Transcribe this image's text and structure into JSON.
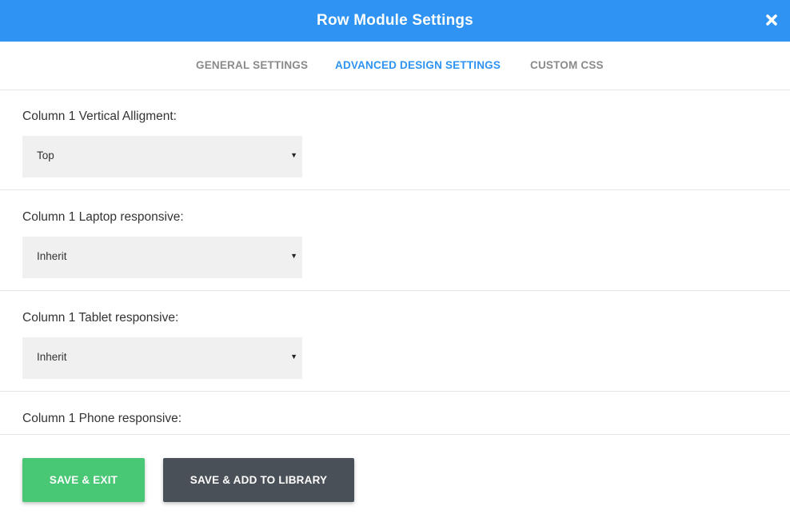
{
  "header": {
    "title": "Row Module Settings",
    "close_icon": "close-icon",
    "color": "#2e93f3"
  },
  "tabs": [
    {
      "label": "GENERAL SETTINGS",
      "active": false
    },
    {
      "label": "ADVANCED DESIGN SETTINGS",
      "active": true
    },
    {
      "label": "CUSTOM CSS",
      "active": false
    }
  ],
  "fields": [
    {
      "label": "Column 1 Vertical Alligment:",
      "value": "Top"
    },
    {
      "label": "Column 1 Laptop responsive:",
      "value": "Inherit"
    },
    {
      "label": "Column 1 Tablet responsive:",
      "value": "Inherit"
    },
    {
      "label": "Column 1 Phone responsive:"
    }
  ],
  "footer": {
    "save_exit_label": "SAVE & EXIT",
    "save_library_label": "SAVE & ADD TO LIBRARY",
    "save_color": "#48c774",
    "library_color": "#4a5057"
  }
}
